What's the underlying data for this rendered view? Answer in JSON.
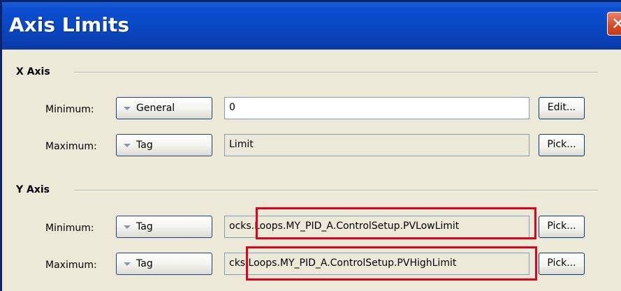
{
  "dialog": {
    "title": "Axis Limits",
    "close_glyph": "✕"
  },
  "x_axis": {
    "title": "X Axis",
    "minimum": {
      "label": "Minimum:",
      "type": "General",
      "value": "0",
      "button": "Edit..."
    },
    "maximum": {
      "label": "Maximum:",
      "type": "Tag",
      "value": "Limit",
      "button": "Pick..."
    }
  },
  "y_axis": {
    "title": "Y Axis",
    "minimum": {
      "label": "Minimum:",
      "type": "Tag",
      "value": "ocks.Loops.MY_PID_A.ControlSetup.PVLowLimit",
      "button": "Pick..."
    },
    "maximum": {
      "label": "Maximum:",
      "type": "Tag",
      "value": "cks.Loops.MY_PID_A.ControlSetup.PVHighLimit",
      "button": "Pick..."
    }
  },
  "colors": {
    "titlebar": "#0847c2",
    "window_bg": "#ece9d8",
    "highlight": "#e3001b"
  }
}
